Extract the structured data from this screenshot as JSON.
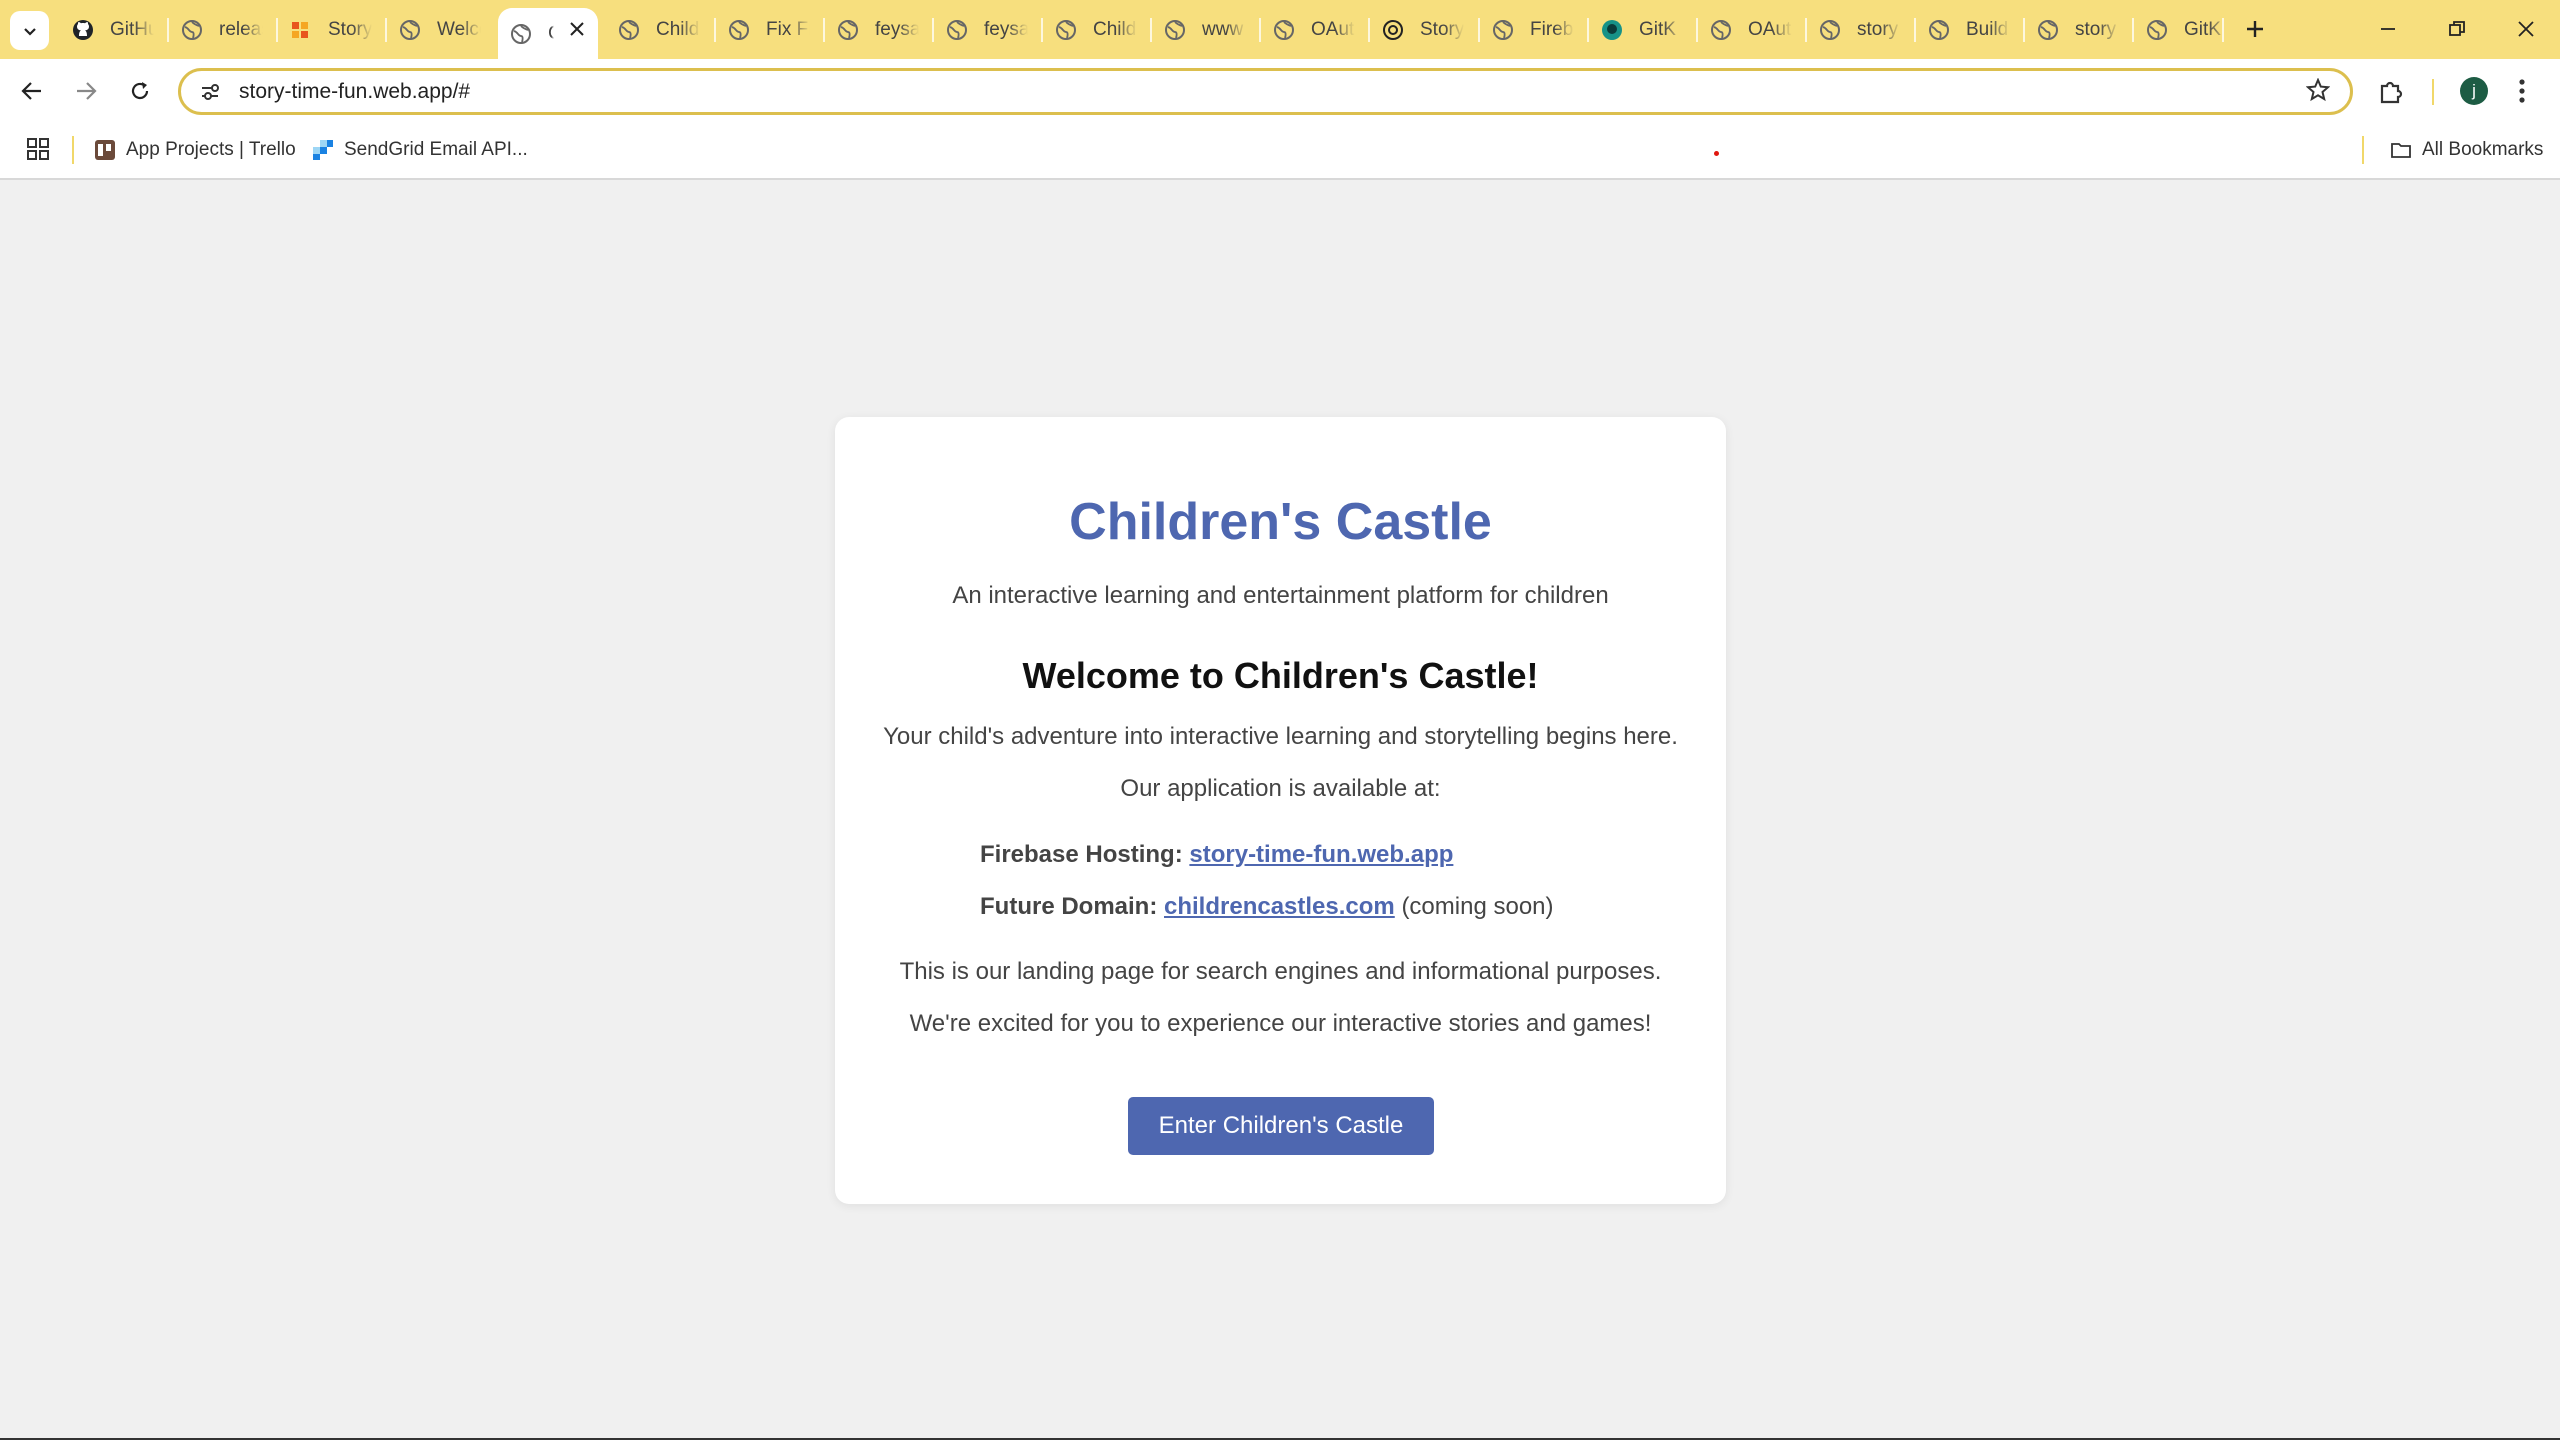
{
  "browser": {
    "tabs": [
      {
        "label": "GitHub",
        "favicon": "github-icon"
      },
      {
        "label": "release",
        "favicon": "globe-icon"
      },
      {
        "label": "Story",
        "favicon": "story-app-icon"
      },
      {
        "label": "Welcome",
        "favicon": "globe-icon"
      },
      {
        "label": "Children's Castle",
        "favicon": "globe-icon",
        "active": true
      },
      {
        "label": "Child",
        "favicon": "globe-icon"
      },
      {
        "label": "Fix Fi",
        "favicon": "globe-icon"
      },
      {
        "label": "feysa",
        "favicon": "globe-icon"
      },
      {
        "label": "feysa",
        "favicon": "globe-icon"
      },
      {
        "label": "Child",
        "favicon": "globe-icon"
      },
      {
        "label": "www",
        "favicon": "globe-icon"
      },
      {
        "label": "OAuth",
        "favicon": "globe-icon"
      },
      {
        "label": "Story",
        "favicon": "openai-icon"
      },
      {
        "label": "Fireb",
        "favicon": "globe-icon"
      },
      {
        "label": "GitK",
        "favicon": "gitkraken-icon"
      },
      {
        "label": "OAuth",
        "favicon": "globe-icon"
      },
      {
        "label": "story",
        "favicon": "globe-icon"
      },
      {
        "label": "Build",
        "favicon": "globe-icon"
      },
      {
        "label": "story",
        "favicon": "globe-icon"
      },
      {
        "label": "GitK",
        "favicon": "globe-icon"
      }
    ],
    "url": "story-time-fun.web.app/#",
    "avatar_letter": "j",
    "bookmarks": [
      {
        "label": "App Projects | Trello",
        "icon": "trello-icon"
      },
      {
        "label": "SendGrid Email API...",
        "icon": "sendgrid-icon"
      }
    ],
    "all_bookmarks_label": "All Bookmarks"
  },
  "page": {
    "title": "Children's Castle",
    "tagline": "An interactive learning and entertainment platform for children",
    "welcome_heading": "Welcome to Children's Castle!",
    "intro": "Your child's adventure into interactive learning and storytelling begins here.",
    "available_at": "Our application is available at:",
    "hosting_label": "Firebase Hosting:",
    "hosting_link": "story-time-fun.web.app",
    "domain_label": "Future Domain:",
    "domain_link": "childrencastles.com",
    "domain_note": "(coming soon)",
    "landing_note": "This is our landing page for search engines and informational purposes.",
    "excited_note": "We're excited for you to experience our interactive stories and games!",
    "enter_button": "Enter Children's Castle"
  },
  "colors": {
    "chrome_frame": "#f7df7e",
    "accent": "#4e67b0",
    "page_bg": "#f0f0f0"
  }
}
